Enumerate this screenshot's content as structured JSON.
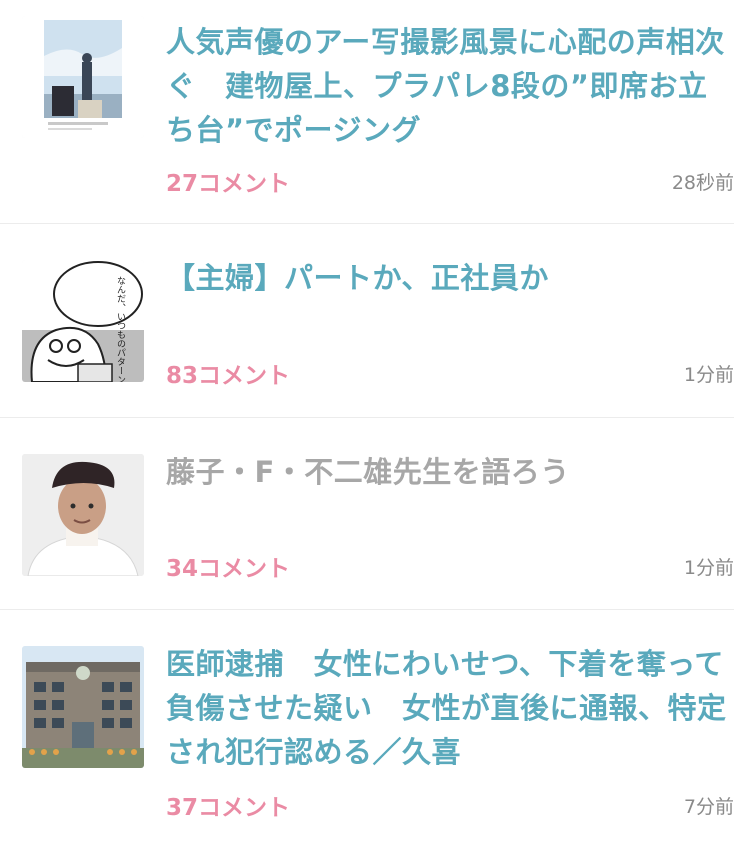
{
  "articles": [
    {
      "title": "人気声優のアー写撮影風景に心配の声相次ぐ　建物屋上、プラパレ8段の”即席お立ち台”でポージング",
      "comments": "27コメント",
      "time": "28秒前",
      "visited": false
    },
    {
      "title": "【主婦】パートか、正社員か",
      "comments": "83コメント",
      "time": "1分前",
      "visited": false,
      "thumb_text": "なんだ、いつものパターンか。"
    },
    {
      "title": "藤子・F・不二雄先生を語ろう",
      "comments": "34コメント",
      "time": "1分前",
      "visited": true
    },
    {
      "title": "医師逮捕　女性にわいせつ、下着を奪って負傷させた疑い　女性が直後に通報、特定され犯行認める／久喜",
      "comments": "37コメント",
      "time": "7分前",
      "visited": false
    }
  ],
  "colors": {
    "title": "#5aa9bc",
    "title_visited": "#a7a7a7",
    "comments": "#ea8ba4",
    "time": "#8a8a8a",
    "divider": "#ececec"
  }
}
